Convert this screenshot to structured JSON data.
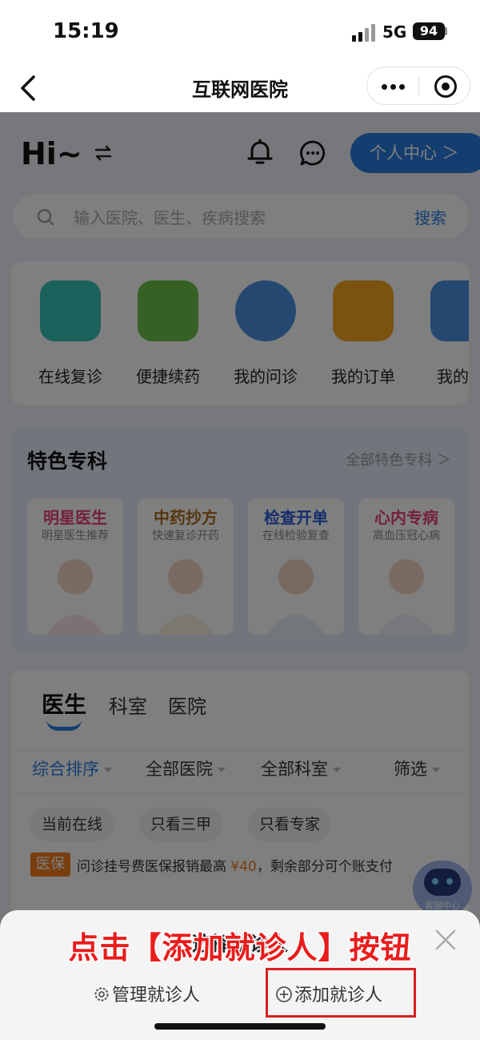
{
  "status_bar": {
    "time": "15:19",
    "network": "5G",
    "battery": "94"
  },
  "nav": {
    "title": "互联网医院"
  },
  "header": {
    "greeting": "Hi~",
    "personal_center_label": "个人中心 ＞"
  },
  "search": {
    "placeholder": "输入医院、医生、疾病搜索",
    "button": "搜索"
  },
  "quick_actions": [
    {
      "label": "在线复诊",
      "icon": "lightning-chat-icon",
      "color": "#36c3b8"
    },
    {
      "label": "便捷续药",
      "icon": "pill-icon",
      "color": "#6cc24a"
    },
    {
      "label": "我的问诊",
      "icon": "doctor-icon",
      "color": "#4a90e2"
    },
    {
      "label": "我的订单",
      "icon": "order-icon",
      "color": "#f5a623"
    },
    {
      "label": "我的病",
      "icon": "medical-folder-icon",
      "color": "#4a90e2"
    }
  ],
  "special": {
    "title": "特色专科",
    "all_label": "全部特色专科 ＞",
    "cards": [
      {
        "title": "明星医生",
        "subtitle": "明星医生推荐",
        "color": "#e8417a"
      },
      {
        "title": "中药抄方",
        "subtitle": "快速复诊开药",
        "color": "#a86a1e"
      },
      {
        "title": "检查开单",
        "subtitle": "在线检验复查",
        "color": "#2a5bd7"
      },
      {
        "title": "心内专病",
        "subtitle": "高血压冠心病",
        "color": "#e8417a"
      }
    ]
  },
  "doctor_section": {
    "tabs": [
      "医生",
      "科室",
      "医院"
    ],
    "filters": [
      "综合排序",
      "全部医院",
      "全部科室",
      "筛选"
    ],
    "chips": [
      "当前在线",
      "只看三甲",
      "只看专家"
    ],
    "insurance": {
      "badge": "医保",
      "text_before": "问诊挂号费医保报销最高 ",
      "amount": "¥40",
      "text_after": "，剩余部分可个账支付"
    }
  },
  "service_bot": {
    "label": "客服中心"
  },
  "sheet": {
    "title": "选择就诊人",
    "manage_label": "管理就诊人",
    "add_label": "添加就诊人"
  },
  "annotation": {
    "text": "点击【添加就诊人】按钮"
  }
}
